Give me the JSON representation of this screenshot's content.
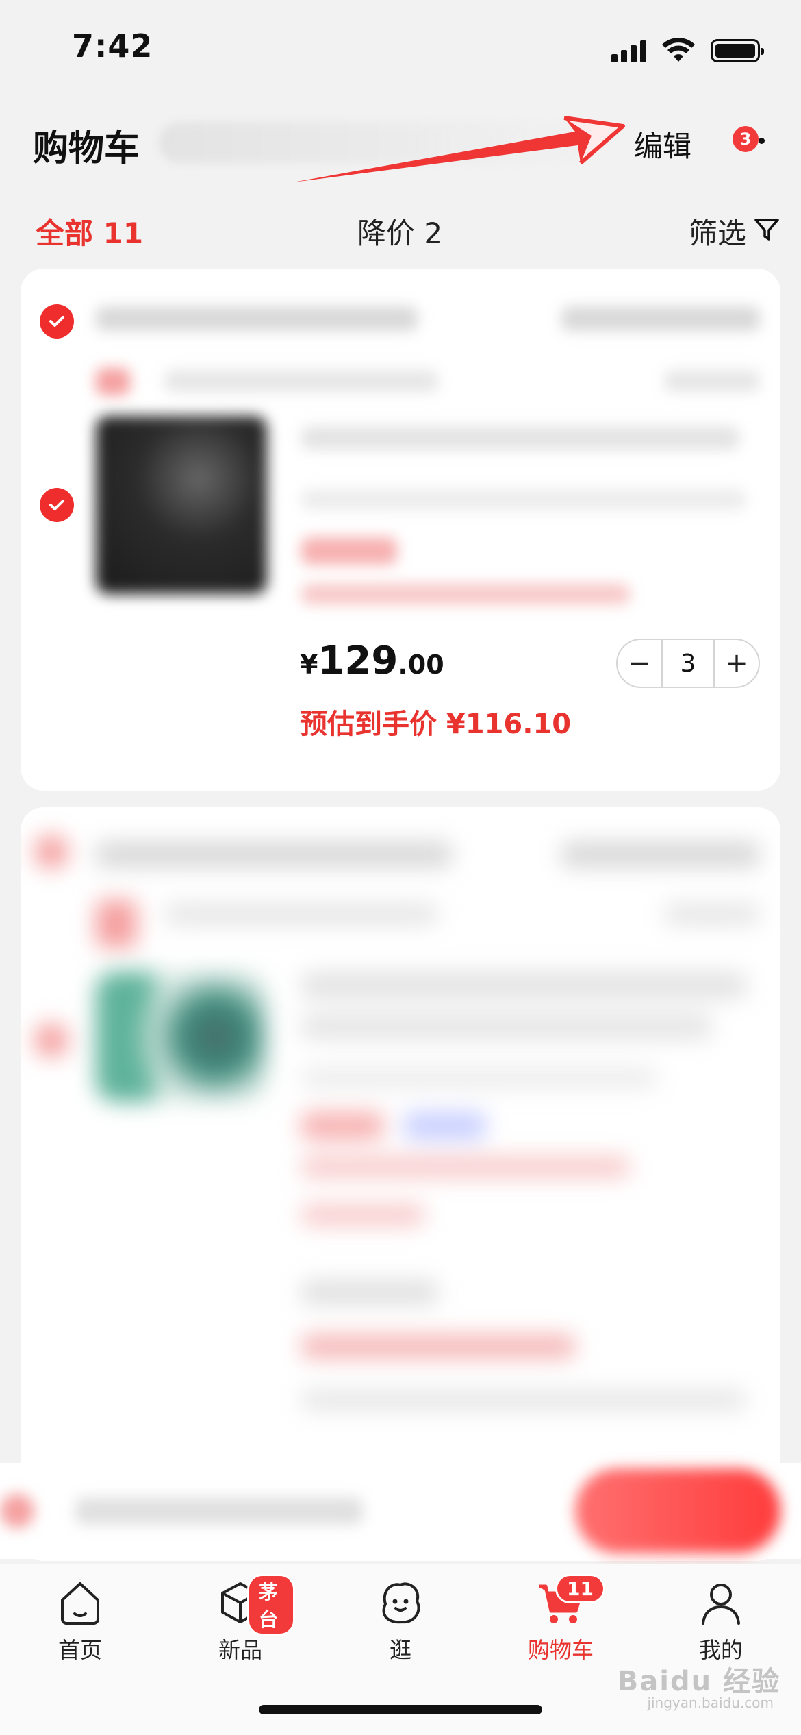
{
  "status_bar": {
    "time": "7:42"
  },
  "header": {
    "title": "购物车",
    "edit_label": "编辑",
    "more_badge": "3"
  },
  "tabs": {
    "all": "全部 11",
    "price_drop": "降价 2",
    "filter": "筛选"
  },
  "item1": {
    "price_currency": "¥",
    "price_int": "129",
    "price_dec": ".00",
    "estimated_label": "预估到手价 ¥116.10",
    "quantity": "3",
    "minus": "−",
    "plus": "+"
  },
  "tabbar": {
    "items": [
      {
        "label": "首页",
        "icon": "home-icon"
      },
      {
        "label": "新品",
        "icon": "cube-icon",
        "badge": "茅台"
      },
      {
        "label": "逛",
        "icon": "face-icon"
      },
      {
        "label": "购物车",
        "icon": "cart-icon",
        "badge": "11",
        "active": true
      },
      {
        "label": "我的",
        "icon": "user-icon"
      }
    ]
  },
  "watermark": {
    "brand": "Baidu 经验",
    "url": "jingyan.baidu.com"
  },
  "colors": {
    "accent": "#e8332f",
    "badge": "#f23a3a"
  }
}
